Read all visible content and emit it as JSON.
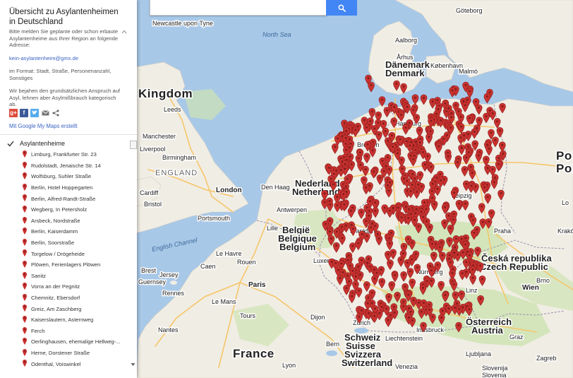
{
  "search": {
    "placeholder": ""
  },
  "panel": {
    "title": "Übersicht zu Asylantenheimen in Deutschland",
    "description": [
      "Bitte melden Sie geplante oder schon erbaute Asylantenheime aus Ihrer Region an folgende Adresse:",
      "kein-asylantenheim@gmx.de",
      "im Format: Stadt, Straße, Personenanzahl, Sonstiges",
      "Wir bejahen den grundsätzlichen Anspruch auf Asyl, lehnen aber Asylmißbrauch kategorisch ab."
    ],
    "share_icons": [
      "google-plus-icon",
      "facebook-icon",
      "twitter-icon",
      "email-icon",
      "share-icon"
    ],
    "made_with": "Mit Google My Maps erstellt"
  },
  "layer": {
    "title": "Asylantenheime",
    "checked": true,
    "marker_color": "#c8312f",
    "places": [
      "Limburg, Frankfurter Str. 23",
      "Rudolstadt, Jenaische Str. 14",
      "Wolfsburg, Suhler Straße",
      "Berlin, Hotel Hoppegarten",
      "Berlin, Alfred-Randt-Straße",
      "Wegberg, In Petersholz",
      "Arsbeck, Nordstraße",
      "Berlin, Kaiserdamm",
      "Berlin, Soorstraße",
      "Torgelow / Drögeheide",
      "Plöwen, Ferienlagers Plöwen",
      "Sanitz",
      "Vorra an der Pegnitz",
      "Chemnitz, Ebersdorf",
      "Greiz, Am Zaschberg",
      "Kaiserslautern, Asternweg",
      "Ferch",
      "Oerlinghausen, ehemalige Hellweg-...",
      "Herne, Dorstener Straße",
      "Odenthal, Voiswinkel"
    ]
  },
  "map": {
    "colors": {
      "water": "#a8c8e8",
      "land": "#f0ede4",
      "green": "#cfe3b4",
      "marker": "#c8312f"
    },
    "labels": {
      "sea": [
        "North Sea",
        "English Channel"
      ],
      "countries": [
        "Dänemark",
        "Denmark",
        "Kingdom",
        "ENGLAND",
        "Nederland",
        "Netherlands",
        "België",
        "Belgique",
        "Belgium",
        "France",
        "Schweiz",
        "Suisse",
        "Svizzera",
        "Switzerland",
        "Česká republika",
        "Czech Republic",
        "Österreich",
        "Austria",
        "Pol",
        "Pola",
        "Slovenija",
        "Slovenia",
        "Liechtenstein",
        "Luxemb"
      ],
      "cities": [
        "Göteborg",
        "Aalborg",
        "Århus",
        "København",
        "Malmö",
        "Newcastle upon Tyne",
        "Leeds",
        "Manchester",
        "Liverpool",
        "Birmingham",
        "Cardiff",
        "Bristol",
        "London",
        "Portsmouth",
        "Den Haag",
        "Antwerpen",
        "Lille",
        "Le Havre",
        "Rouen",
        "Paris",
        "Caen",
        "Rennes",
        "Nantes",
        "Le Mans",
        "Tours",
        "Brest",
        "Guernsey",
        "Jersey",
        "Dijon",
        "Lyon",
        "Zürich",
        "Bern",
        "Innsbruck",
        "Linz",
        "Wien",
        "Graz",
        "Ljubljana",
        "Zagreb",
        "Venezia",
        "Nürnberg",
        "Frankfurt",
        "Bremen",
        "Hamburg",
        "Leipzig",
        "Praha",
        "Brno",
        "Kraków",
        "Lo"
      ]
    },
    "marker_count_note": ""
  }
}
